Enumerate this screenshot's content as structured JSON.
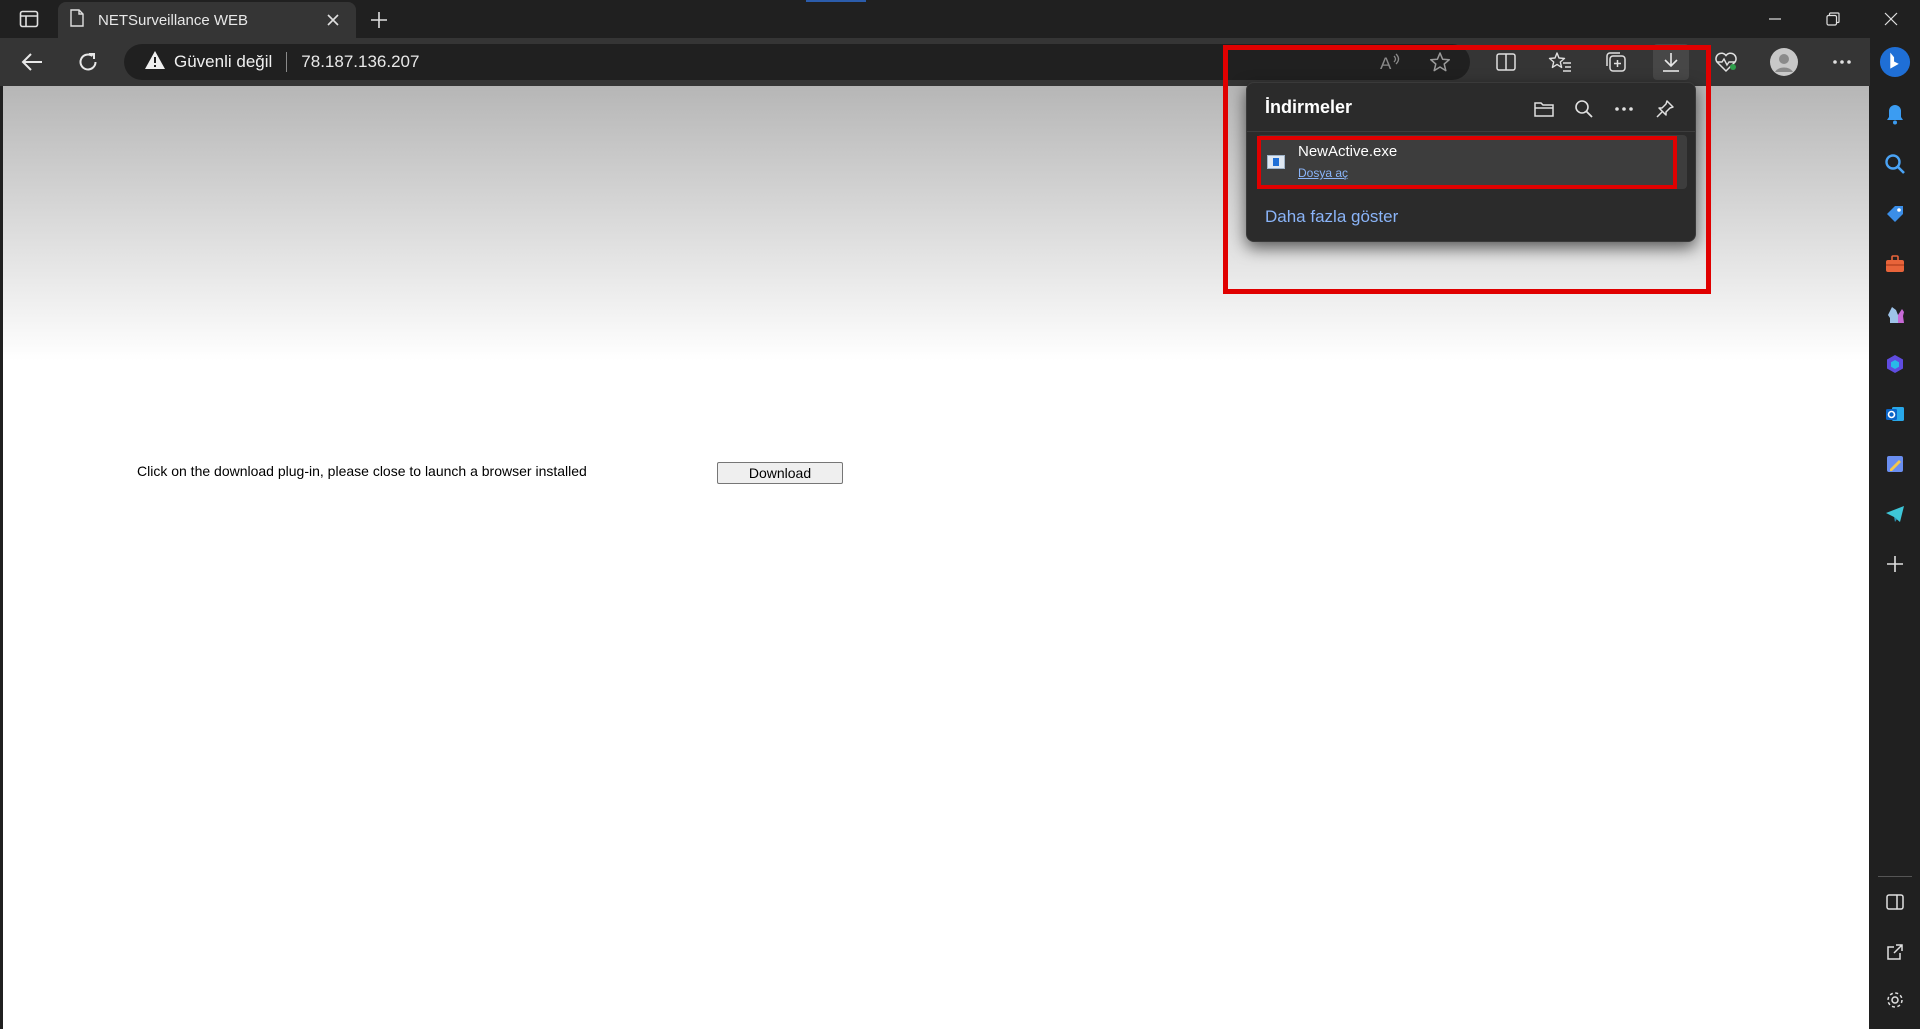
{
  "browser": {
    "tab": {
      "title": "NETSurveillance WEB"
    },
    "address": {
      "security_label": "Güvenli değil",
      "url": "78.187.136.207"
    }
  },
  "page": {
    "instruction": "Click on the download plug-in, please close to launch a browser installed",
    "download_button": "Download"
  },
  "downloads_panel": {
    "title": "İndirmeler",
    "items": [
      {
        "filename": "NewActive.exe",
        "action": "Dosya aç"
      }
    ],
    "show_more": "Daha fazla göster"
  },
  "colors": {
    "annotation": "#e00000",
    "link": "#8ab4f8",
    "toolbar": "#353535",
    "chrome": "#202020"
  },
  "icons": {
    "toolbar": [
      "back-icon",
      "refresh-icon",
      "warning-icon",
      "read-aloud-icon",
      "favorite-star-icon",
      "split-screen-icon",
      "favorites-icon",
      "collections-icon",
      "download-icon",
      "browser-essentials-icon",
      "profile-icon",
      "more-icon"
    ],
    "sidebar": [
      "bing-copilot-icon",
      "notifications-icon",
      "search-icon",
      "shopping-icon",
      "tools-icon",
      "games-icon",
      "microsoft-365-icon",
      "outlook-icon",
      "designer-icon",
      "telegram-icon",
      "add-icon",
      "sidebar-toggle-icon",
      "external-link-icon",
      "settings-icon"
    ]
  }
}
